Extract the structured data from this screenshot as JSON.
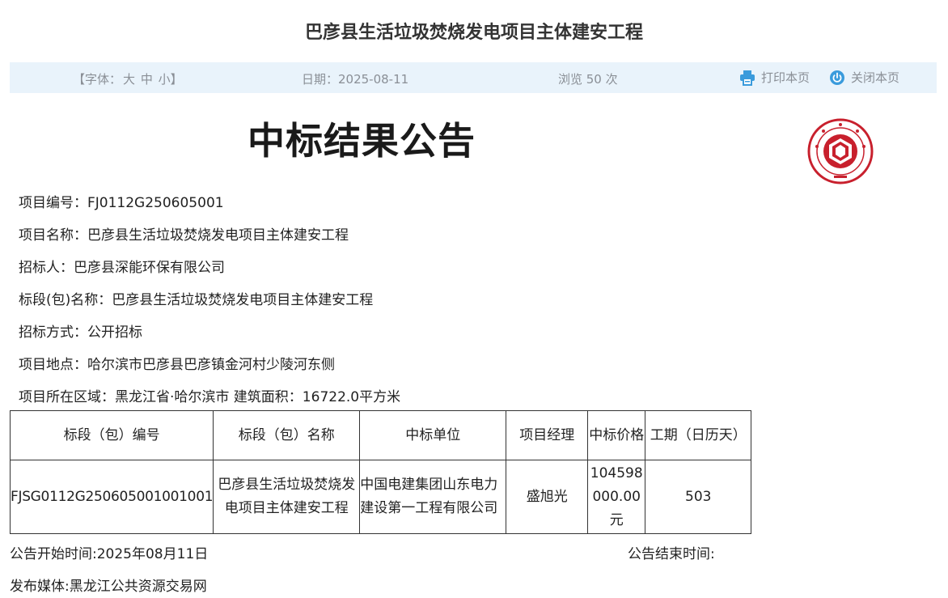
{
  "page_title": "巴彦县生活垃圾焚烧发电项目主体建安工程",
  "toolbar": {
    "font_label_open": "【字体：",
    "font_large": "大",
    "font_medium": "中",
    "font_small": "小",
    "font_label_close": "】",
    "date": "日期：2025-08-11",
    "views": "浏览 50 次",
    "print_label": "打印本页",
    "close_label": "关闭本页"
  },
  "notice": {
    "heading": "中标结果公告",
    "fields": {
      "project_no": "项目编号：FJ0112G250605001",
      "project_name": "项目名称：巴彦县生活垃圾焚烧发电项目主体建安工程",
      "tenderer": "招标人：巴彦县深能环保有限公司",
      "section_name": "标段(包)名称：巴彦县生活垃圾焚烧发电项目主体建安工程",
      "tender_method": "招标方式：公开招标",
      "location": "项目地点：哈尔滨市巴彦县巴彦镇金河村少陵河东侧",
      "region_area": "项目所在区域：黑龙江省·哈尔滨市  建筑面积：16722.0平方米"
    },
    "table": {
      "headers": [
        "标段（包）编号",
        "标段（包）名称",
        "中标单位",
        "项目经理",
        "中标价格",
        "工期（日历天）"
      ],
      "rows": [
        [
          "FJSG0112G250605001001001",
          "巴彦县生活垃圾焚烧发电项目主体建安工程",
          "中国电建集团山东电力建设第一工程有限公司",
          "盛旭光",
          "104598000.00元",
          "503"
        ]
      ]
    },
    "start_time": "公告开始时间:2025年08月11日",
    "end_time": "公告结束时间:",
    "media": "发布媒体:黑龙江公共资源交易网"
  },
  "colors": {
    "toolbar_bg": "#e9f3fb",
    "toolbar_text": "#8a8f96",
    "icon_blue": "#3a9bdc",
    "seal_red": "#c8202d"
  }
}
